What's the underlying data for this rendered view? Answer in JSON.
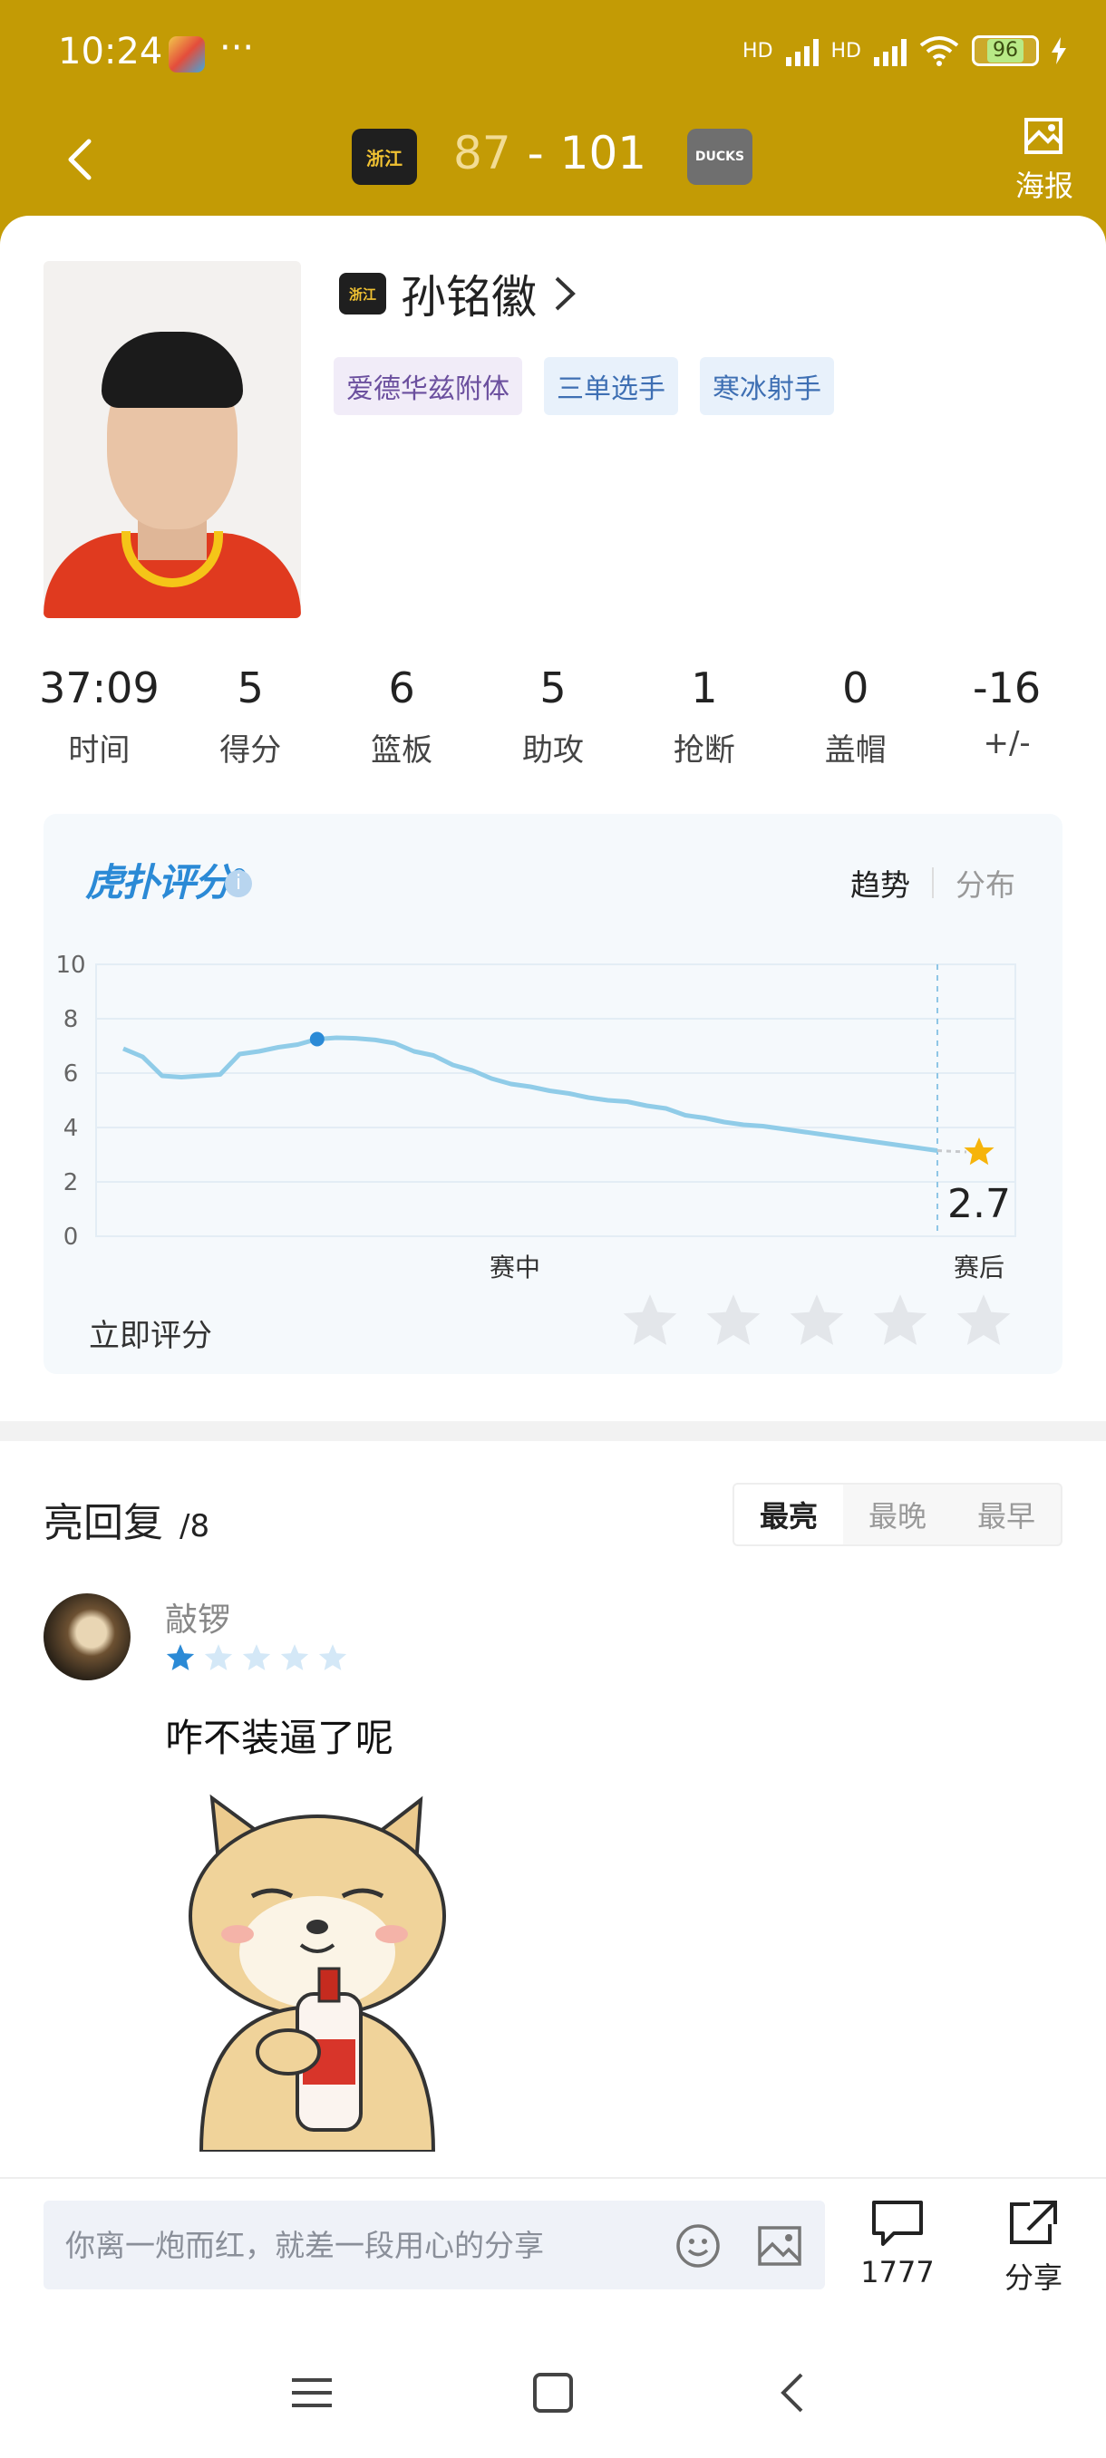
{
  "status_bar": {
    "time": "10:24",
    "dots": "···",
    "network1": "HD",
    "network2": "HD",
    "battery": "96"
  },
  "header": {
    "home_team_logo": "浙江",
    "away_team_logo": "DUCKS",
    "home_score": "87",
    "separator": "-",
    "away_score": "101",
    "poster_label": "海报"
  },
  "player": {
    "name": "孙铭徽",
    "tags": [
      "爱德华兹附体",
      "三单选手",
      "寒冰射手"
    ],
    "stats": [
      {
        "value": "37:09",
        "label": "时间"
      },
      {
        "value": "5",
        "label": "得分"
      },
      {
        "value": "6",
        "label": "篮板"
      },
      {
        "value": "5",
        "label": "助攻"
      },
      {
        "value": "1",
        "label": "抢断"
      },
      {
        "value": "0",
        "label": "盖帽"
      },
      {
        "value": "-16",
        "label": "+/-"
      }
    ]
  },
  "rating": {
    "logo": "虎扑评分",
    "logo_mark": "®",
    "tab_trend": "趋势",
    "tab_distribution": "分布",
    "rate_now_label": "立即评分",
    "final_score": "2.7",
    "x_mid_label": "赛中",
    "x_end_label": "赛后"
  },
  "chart_data": {
    "type": "line",
    "ylim": [
      0,
      10
    ],
    "yticks": [
      "10",
      "8",
      "6",
      "4",
      "2",
      "0"
    ],
    "x_labels": [
      "赛中",
      "赛后"
    ],
    "series": [
      {
        "values": [
          6.9,
          6.6,
          5.9,
          5.85,
          5.9,
          5.95,
          6.7,
          6.8,
          6.95,
          7.05,
          7.25,
          7.3,
          7.28,
          7.22,
          7.1,
          6.8,
          6.65,
          6.3,
          6.1,
          5.8,
          5.6,
          5.5,
          5.35,
          5.25,
          5.1,
          5.0,
          4.95,
          4.8,
          4.7,
          4.45,
          4.35,
          4.2,
          4.1,
          4.05,
          3.95,
          3.85,
          3.75,
          3.65,
          3.55,
          3.45,
          3.35,
          3.25,
          3.15
        ],
        "highlight_index": 10
      }
    ],
    "final_value": 2.7,
    "grid": true
  },
  "comments": {
    "title": "亮回复",
    "count": "/8",
    "sort_options": [
      "最亮",
      "最晚",
      "最早"
    ],
    "items": [
      {
        "user": "敲锣",
        "rating": 1,
        "text": "咋不装逼了呢"
      }
    ]
  },
  "input_bar": {
    "placeholder": "你离一炮而红，就差一段用心的分享",
    "comment_count": "1777",
    "share_label": "分享"
  },
  "colors": {
    "accent_gold": "#c39b05",
    "chart_line": "#90cce8",
    "star_active": "#2b8ad6",
    "star_final": "#f6b40b"
  }
}
